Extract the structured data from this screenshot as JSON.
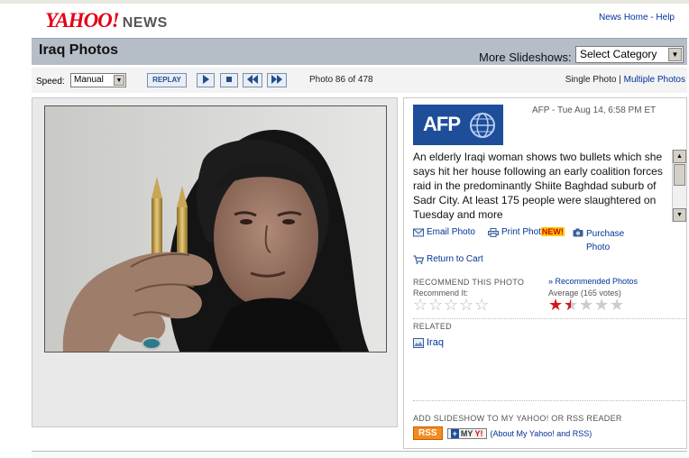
{
  "header": {
    "logo_text": "YAHOO!",
    "logo_suffix": "NEWS",
    "links": [
      "News Home",
      "Help"
    ],
    "link_separator": "-"
  },
  "titlebar": {
    "title": "Iraq Photos",
    "more_label": "More Slideshows:",
    "category_select": "Select Category"
  },
  "controls": {
    "speed_label": "Speed:",
    "speed_value": "Manual",
    "replay_label": "REPLAY",
    "counter": "Photo 86 of 478",
    "single_photo": "Single Photo",
    "multiple_photos": "Multiple Photos",
    "view_separator": "|"
  },
  "photo": {
    "alt": "Elderly Iraqi woman holding two bullets"
  },
  "info": {
    "source_logo": "AFP",
    "byline": "AFP - Tue Aug 14, 6:58 PM ET",
    "caption": "An elderly Iraqi woman shows two bullets which she says hit her house following an early coalition forces raid in the predominantly Shiite Baghdad suburb of Sadr City. At least 175 people were slaughtered on Tuesday and more",
    "email_photo": "Email Photo",
    "print_photo": "Print Phot",
    "new_badge": "NEW!",
    "purchase_photo_1": "Purchase",
    "purchase_photo_2": "Photo",
    "return_to_cart": "Return to Cart",
    "recommend_heading": "RECOMMEND THIS PHOTO",
    "recommend_it": "Recommend It:",
    "recommended_link": "» Recommended Photos",
    "average_label": "Average (165 votes)",
    "average_rating": 1.5,
    "related_heading": "RELATED",
    "related_link": "Iraq",
    "add_heading": "ADD SLIDESHOW TO MY YAHOO! OR RSS READER",
    "rss_label": "RSS",
    "myyahoo_label": "MY",
    "myyahoo_y": "Y!",
    "about_link": "(About My Yahoo! and RSS)"
  },
  "colors": {
    "brand_red": "#e40017",
    "link_blue": "#003399",
    "titlebar_bg": "#b5bdc6",
    "afp_blue": "#1e4e9a"
  }
}
